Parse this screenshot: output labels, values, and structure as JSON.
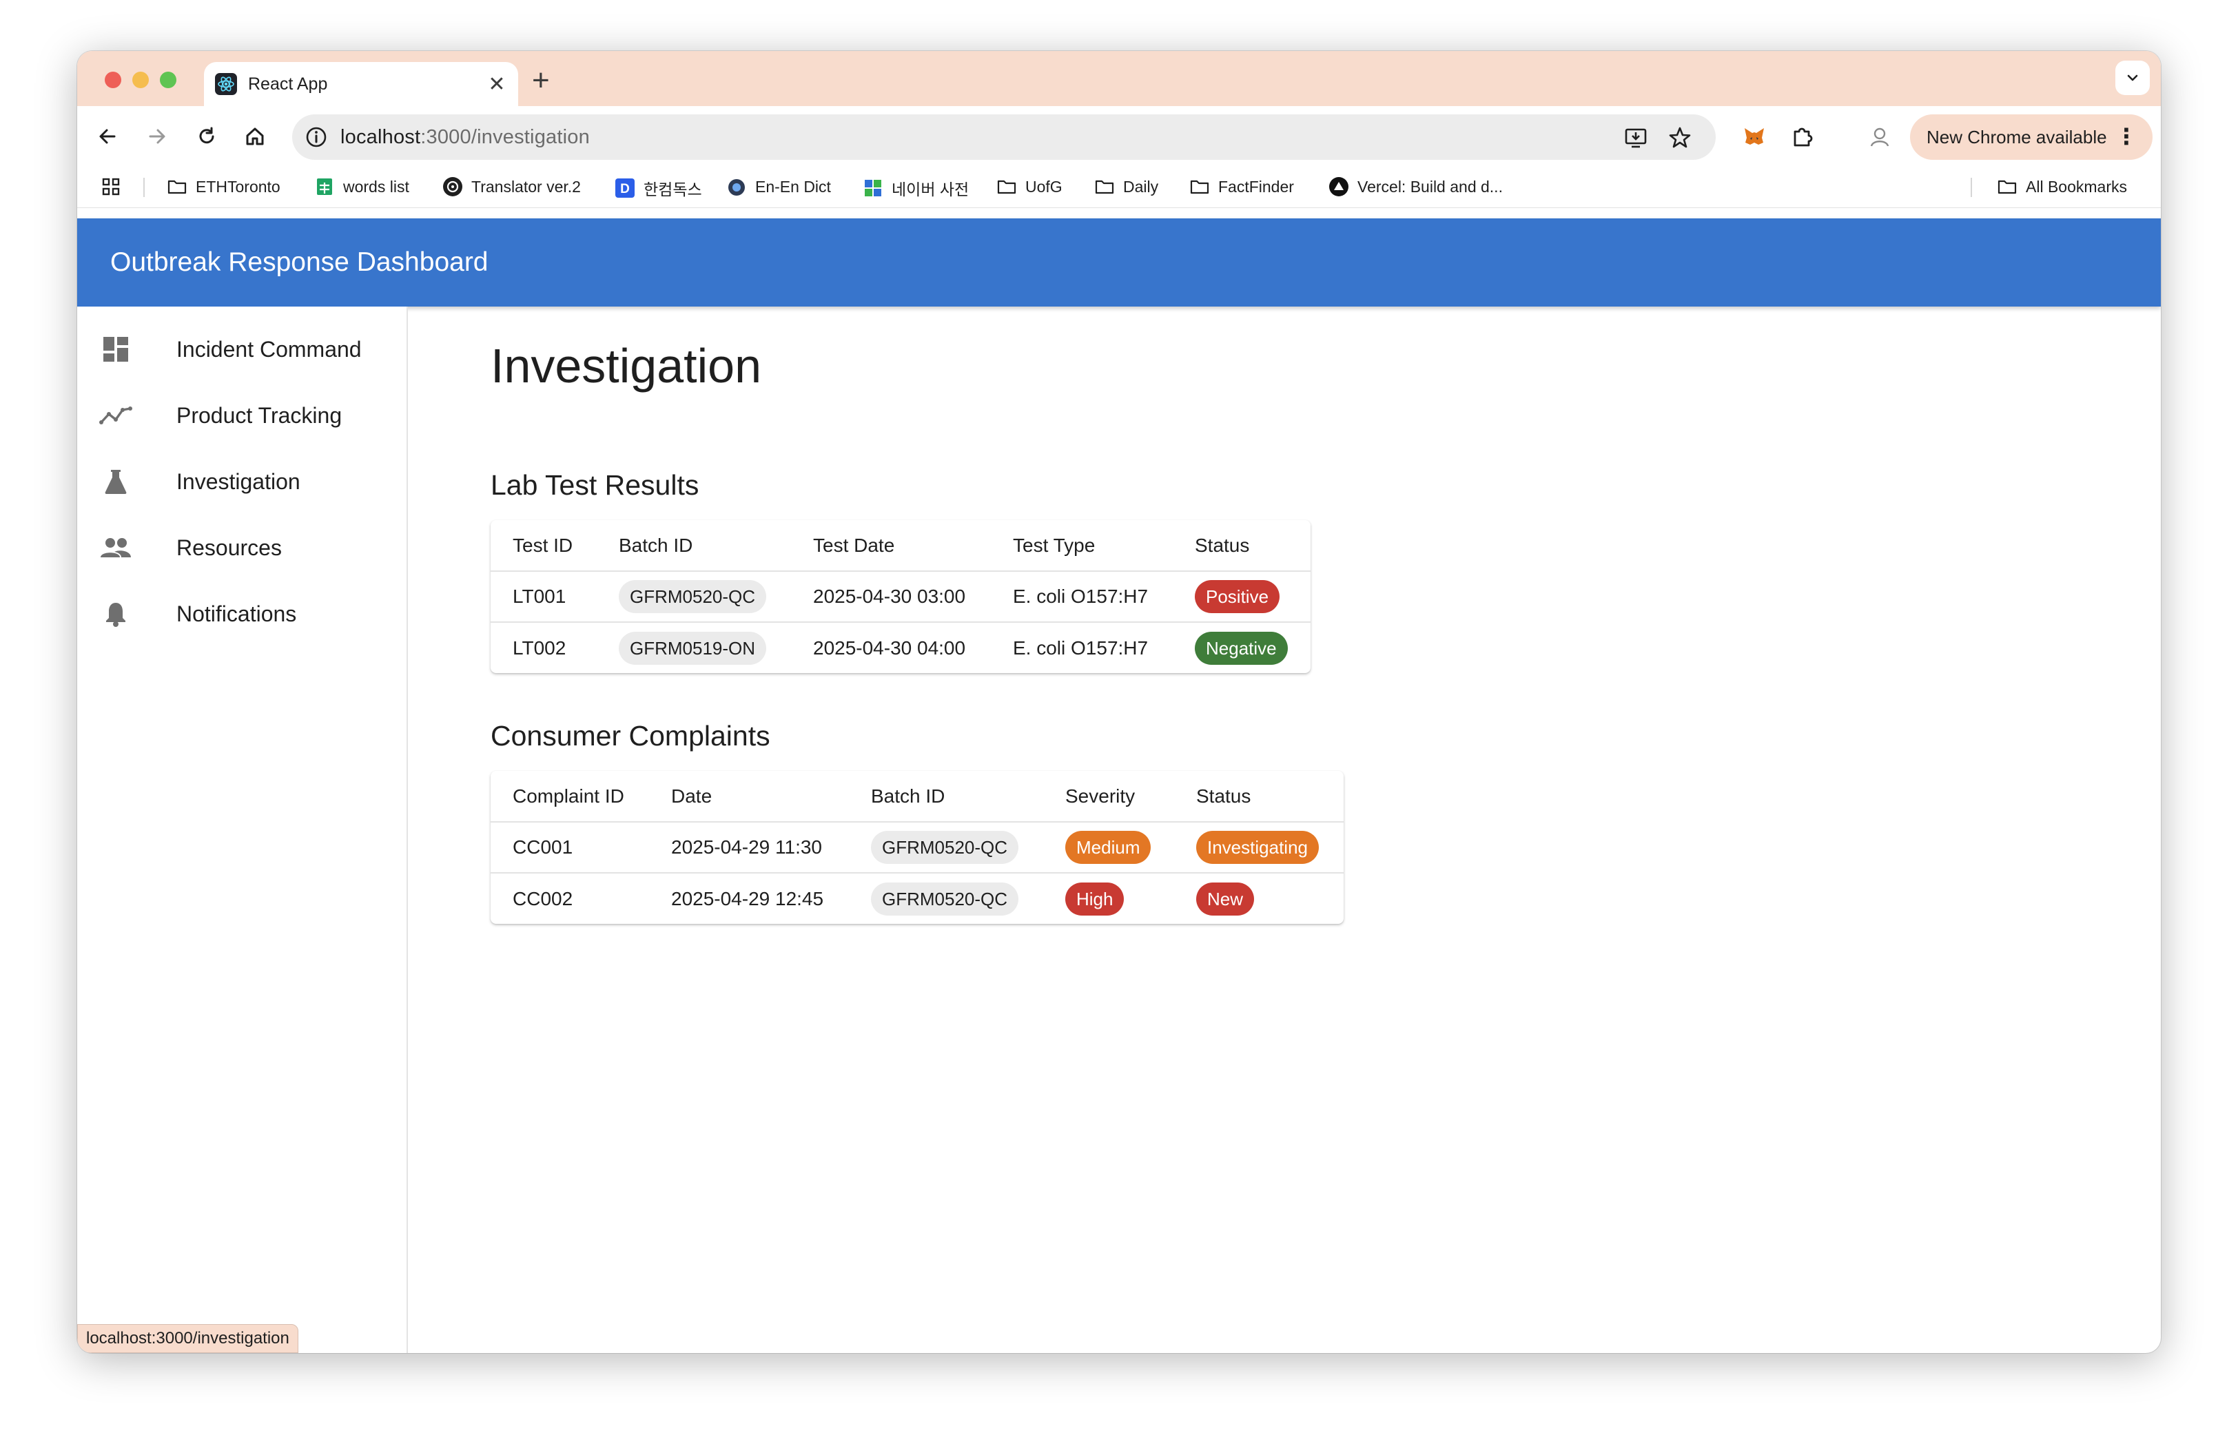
{
  "browser": {
    "tab_title": "React App",
    "new_tab_symbol": "+",
    "close_symbol": "✕",
    "url_host": "localhost",
    "url_path": ":3000/investigation",
    "update_label": "New Chrome available",
    "update_menu": "⋮",
    "status_url": "localhost:3000/investigation",
    "bookmarks": [
      {
        "label": "ETHToronto",
        "icon": "folder-icon"
      },
      {
        "label": "words list",
        "icon": "sheets-icon"
      },
      {
        "label": "Translator ver.2",
        "icon": "openai-icon"
      },
      {
        "label": "한컴독스",
        "icon": "docs-d-icon"
      },
      {
        "label": "En-En Dict",
        "icon": "dict-icon"
      },
      {
        "label": "네이버 사전",
        "icon": "naver-icon"
      },
      {
        "label": "UofG",
        "icon": "folder-icon"
      },
      {
        "label": "Daily",
        "icon": "folder-icon"
      },
      {
        "label": "FactFinder",
        "icon": "folder-icon"
      },
      {
        "label": "Vercel: Build and d...",
        "icon": "vercel-icon"
      }
    ],
    "all_bookmarks": "All Bookmarks"
  },
  "app": {
    "title": "Outbreak Response Dashboard",
    "accent": "#3875cc"
  },
  "nav": [
    {
      "label": "Incident Command",
      "icon": "dashboard-icon"
    },
    {
      "label": "Product Tracking",
      "icon": "timeline-icon"
    },
    {
      "label": "Investigation",
      "icon": "flask-icon"
    },
    {
      "label": "Resources",
      "icon": "people-icon"
    },
    {
      "label": "Notifications",
      "icon": "bell-icon"
    }
  ],
  "page": {
    "title": "Investigation",
    "lab": {
      "title": "Lab Test Results",
      "headers": [
        "Test ID",
        "Batch ID",
        "Test Date",
        "Test Type",
        "Status"
      ],
      "rows": [
        {
          "id": "LT001",
          "batch": "GFRM0520-QC",
          "date": "2025-04-30 03:00",
          "type": "E. coli O157:H7",
          "status": "Positive"
        },
        {
          "id": "LT002",
          "batch": "GFRM0519-ON",
          "date": "2025-04-30 04:00",
          "type": "E. coli O157:H7",
          "status": "Negative"
        }
      ]
    },
    "complaints": {
      "title": "Consumer Complaints",
      "headers": [
        "Complaint ID",
        "Date",
        "Batch ID",
        "Severity",
        "Status"
      ],
      "rows": [
        {
          "id": "CC001",
          "date": "2025-04-29 11:30",
          "batch": "GFRM0520-QC",
          "severity": "Medium",
          "status": "Investigating"
        },
        {
          "id": "CC002",
          "date": "2025-04-29 12:45",
          "batch": "GFRM0520-QC",
          "severity": "High",
          "status": "New"
        }
      ]
    }
  },
  "colors": {
    "positive": "#c83a32",
    "negative": "#3f7d3a",
    "medium": "#e37724",
    "high": "#c83a32"
  }
}
